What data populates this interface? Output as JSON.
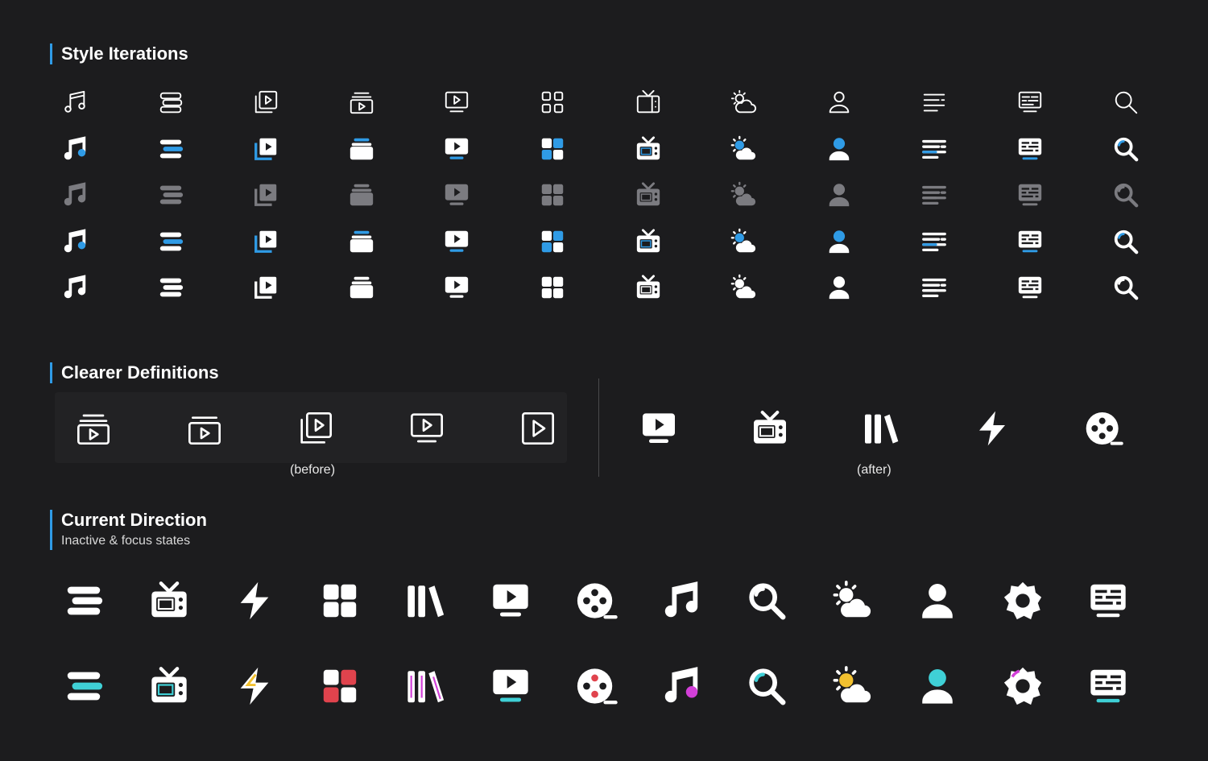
{
  "sections": {
    "style_iterations": {
      "title": "Style Iterations"
    },
    "clearer_definitions": {
      "title": "Clearer Definitions",
      "before_caption": "(before)",
      "after_caption": "(after)"
    },
    "current_direction": {
      "title": "Current Direction",
      "subtitle": "Inactive & focus states"
    }
  },
  "colors": {
    "background": "#1c1c1e",
    "accent": "#2f9be6",
    "muted": "#7b7b80",
    "focus_cyan": "#3fd0d6",
    "focus_magenta": "#d23fd8",
    "focus_yellow": "#f3c12f",
    "focus_red": "#e0434d"
  },
  "style_iterations": {
    "columns": [
      "music-icon",
      "stack-icon",
      "media-library-icon",
      "media-queue-icon",
      "tv-screen-icon",
      "grid-icon",
      "television-icon",
      "weather-icon",
      "person-icon",
      "list-icon",
      "guide-icon",
      "search-icon"
    ],
    "rows": [
      "outline",
      "bold-two-tone",
      "muted-filled",
      "filled-accent",
      "filled-white"
    ]
  },
  "clearer_definitions": {
    "before": [
      "media-queue-icon",
      "media-queue-single-icon",
      "media-library-icon",
      "tv-screen-icon",
      "play-box-icon"
    ],
    "after": [
      "tv-screen-icon",
      "television-icon",
      "library-icon",
      "lightning-icon",
      "film-reel-icon"
    ]
  },
  "current_direction": {
    "icons": [
      "stack-icon",
      "television-icon",
      "lightning-icon",
      "grid-icon",
      "library-icon",
      "tv-screen-icon",
      "film-reel-icon",
      "music-icon",
      "search-icon",
      "weather-icon",
      "person-icon",
      "gear-icon",
      "guide-icon"
    ],
    "states": [
      "inactive",
      "focus"
    ]
  }
}
